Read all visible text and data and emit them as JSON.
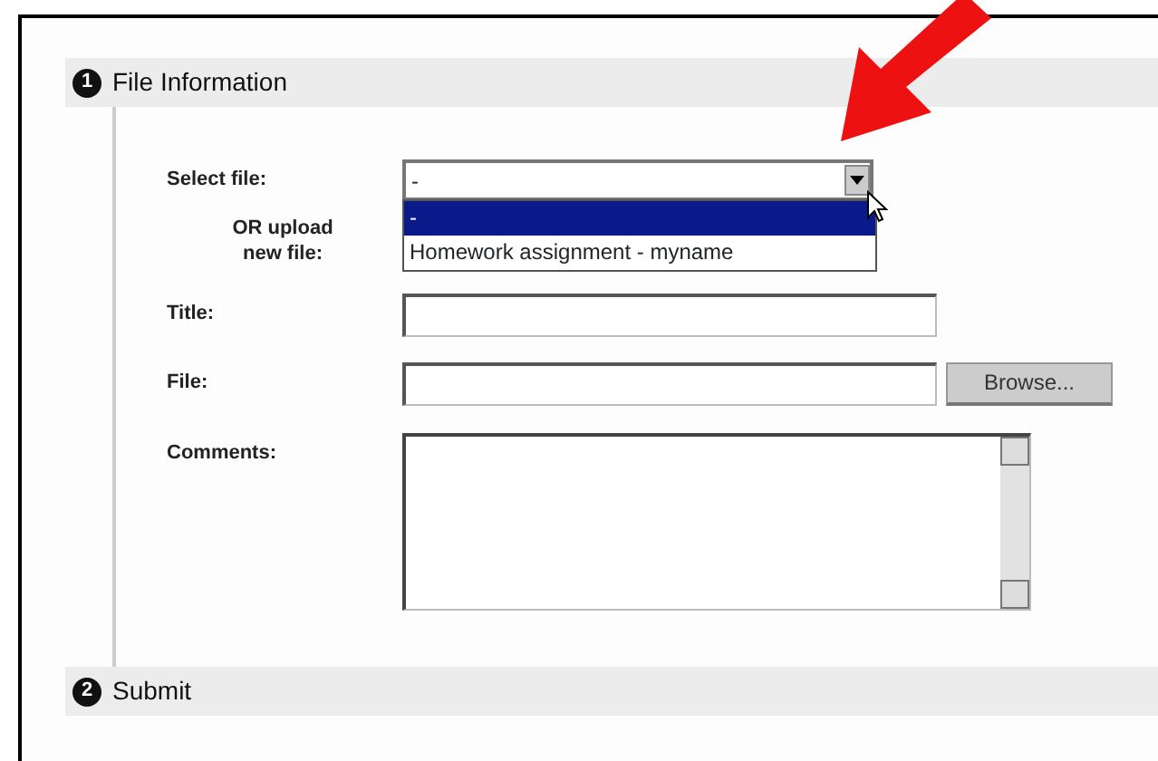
{
  "sections": [
    {
      "number": "1",
      "title": "File Information"
    },
    {
      "number": "2",
      "title": "Submit"
    }
  ],
  "select_file": {
    "label": "Select file:",
    "value": "-",
    "expanded": true,
    "options": [
      {
        "label": "-",
        "selected": true
      },
      {
        "label": "Homework assignment - myname",
        "selected": false
      }
    ]
  },
  "upload_label": "OR upload new file:",
  "title_field": {
    "label": "Title:"
  },
  "file_field": {
    "label": "File:",
    "button": "Browse..."
  },
  "comments_field": {
    "label": "Comments:"
  }
}
